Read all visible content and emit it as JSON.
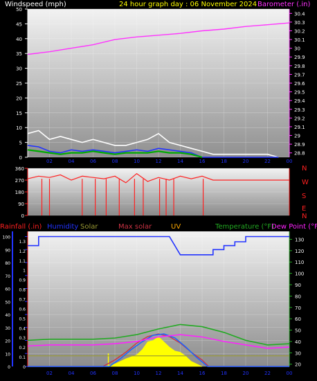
{
  "colors": {
    "white": "#ffffff",
    "yellow": "#ffff00",
    "magenta": "#ff33ff",
    "blue": "#2233ff",
    "green": "#00aa00",
    "red": "#ff2020",
    "uv_orange": "#ffaa00",
    "max_solar": "#cc3344",
    "solar_olive": "#999933",
    "temp_green": "#22aa22",
    "dew_magenta": "#ff22ff"
  },
  "chart_data": [
    {
      "type": "line",
      "name": "wind-barometer",
      "title": "24 hour graph day : 06 November 2024",
      "ylabel_left": "Windspeed (mph)",
      "ylabel_right": "Barometer (.in)",
      "ylim_left": [
        0,
        50
      ],
      "ylim_right": [
        28.75,
        30.45
      ],
      "yticks_left": [
        "0",
        "5",
        "10",
        "15",
        "20",
        "25",
        "30",
        "35",
        "40",
        "45",
        "50"
      ],
      "yticks_right": [
        "28.8",
        "28.9",
        "29",
        "29.1",
        "29.2",
        "29.3",
        "29.4",
        "29.5",
        "29.6",
        "29.7",
        "29.8",
        "29.9",
        "30",
        "30.1",
        "30.2",
        "30.3",
        "30.4"
      ],
      "xticks": [
        "02",
        "04",
        "06",
        "08",
        "10",
        "12",
        "14",
        "16",
        "18",
        "20",
        "22",
        "00"
      ],
      "barometer": {
        "x": [
          0,
          2,
          4,
          6,
          8,
          10,
          12,
          14,
          16,
          18,
          20,
          22,
          24
        ],
        "y": [
          29.93,
          29.96,
          30.0,
          30.04,
          30.1,
          30.13,
          30.15,
          30.17,
          30.2,
          30.22,
          30.25,
          30.27,
          30.29
        ]
      },
      "gust": {
        "x": [
          0,
          1,
          2,
          3,
          4,
          5,
          6,
          7,
          8,
          9,
          10,
          11,
          12,
          13,
          14,
          15,
          16,
          17,
          18,
          19,
          20,
          21,
          22,
          23
        ],
        "y": [
          8,
          9,
          6,
          7,
          6,
          5,
          6,
          5,
          4,
          4,
          5,
          6,
          8,
          5,
          4,
          3,
          2,
          1,
          1,
          1,
          1,
          1,
          1,
          0
        ]
      },
      "avg": {
        "x": [
          0,
          1,
          2,
          3,
          4,
          5,
          6,
          7,
          8,
          9,
          10,
          11,
          12,
          13,
          14,
          15,
          16,
          17,
          18,
          19,
          20,
          21,
          22,
          23
        ],
        "y": [
          4,
          3.5,
          2,
          1.5,
          2.5,
          2,
          2.5,
          2,
          1.5,
          2,
          2.5,
          2,
          3,
          2.5,
          2,
          1.5,
          0,
          0,
          0,
          0,
          0,
          0,
          0,
          0
        ]
      },
      "wind_green": {
        "x": [
          0,
          1,
          2,
          3,
          4,
          5,
          6,
          7,
          8,
          9,
          10,
          11,
          12,
          13,
          14,
          15,
          16
        ],
        "y": [
          2.5,
          2,
          1.5,
          1,
          1.5,
          1.5,
          2,
          1.5,
          1,
          1.5,
          1.5,
          1.5,
          2,
          1.5,
          1.5,
          1,
          0
        ]
      }
    },
    {
      "type": "scatter",
      "name": "wind-direction",
      "yticks_left": [
        "0",
        "90",
        "180",
        "270",
        "360"
      ],
      "ylim": [
        0,
        360
      ],
      "compass": [
        "N",
        "W",
        "S",
        "E",
        "N"
      ],
      "direction": {
        "x": [
          0,
          1,
          2,
          3,
          4,
          5,
          6,
          7,
          8,
          9,
          10,
          11,
          12,
          13,
          14,
          15,
          16,
          17,
          18,
          19,
          20,
          21,
          22,
          23,
          24
        ],
        "y": [
          280,
          300,
          290,
          310,
          270,
          300,
          290,
          280,
          300,
          250,
          320,
          260,
          290,
          270,
          300,
          280,
          300,
          270,
          270,
          270,
          270,
          270,
          270,
          270,
          270
        ]
      }
    },
    {
      "type": "line",
      "name": "weather-multi",
      "labels": {
        "rainfall": "Rainfall (.in)",
        "humidity": "Humidity",
        "solar": "Solar",
        "max_solar": "Max solar",
        "uv": "UV",
        "temperature": "Temperature (°F)",
        "dew_point": "Dew Point (°F"
      },
      "yticks_humidity": [
        "0",
        "10",
        "20",
        "30",
        "40",
        "50",
        "60",
        "70",
        "80",
        "90",
        "100"
      ],
      "yticks_rain": [
        "0",
        "0.1",
        "0.2",
        "0.3",
        "0.4",
        "0.5",
        "0.6",
        "0.7",
        "0.8",
        "0.9",
        "1",
        "1.1",
        "1.2",
        "1.3"
      ],
      "yticks_temp": [
        "20",
        "30",
        "40",
        "50",
        "60",
        "70",
        "80",
        "90",
        "100",
        "110",
        "120",
        "130"
      ],
      "xticks": [
        "02",
        "04",
        "06",
        "08",
        "10",
        "12",
        "14",
        "16",
        "18",
        "20",
        "22",
        "00"
      ],
      "ylim_humidity": [
        0,
        104
      ],
      "ylim_temp": [
        18,
        137
      ],
      "humidity": {
        "x": [
          0,
          1,
          1,
          6,
          11,
          12,
          13,
          14,
          15,
          16,
          17,
          17,
          18,
          18,
          19,
          19,
          20,
          20,
          24
        ],
        "y": [
          93,
          93,
          100,
          100,
          100,
          100,
          100,
          86,
          86,
          86,
          86,
          90,
          90,
          93,
          93,
          96,
          96,
          100,
          100
        ]
      },
      "temperature": {
        "x": [
          0,
          2,
          4,
          6,
          8,
          10,
          12,
          14,
          16,
          18,
          20,
          22,
          24
        ],
        "y": [
          41,
          42,
          42,
          42,
          43,
          46,
          51,
          55,
          53,
          48,
          41,
          37,
          38
        ]
      },
      "dew_point": {
        "x": [
          0,
          2,
          4,
          6,
          8,
          10,
          12,
          14,
          16,
          18,
          20,
          22,
          24
        ],
        "y": [
          36,
          37,
          37,
          37,
          38,
          40,
          44,
          46,
          44,
          40,
          37,
          34,
          35
        ]
      },
      "max_solar": {
        "x": [
          0,
          6.9,
          8,
          9,
          10,
          11,
          12,
          13,
          14,
          15,
          16,
          16.6,
          24
        ],
        "y": [
          0,
          0,
          5,
          11,
          18,
          23,
          25,
          23,
          18,
          11,
          5,
          0,
          0
        ]
      },
      "uv": {
        "x": [
          0,
          7.5,
          8.5,
          9.5,
          10.5,
          11.5,
          12.5,
          13.5,
          14.5,
          15.5,
          16.5,
          24
        ],
        "y": [
          0,
          0,
          6,
          13,
          19,
          24,
          25,
          22,
          15,
          7,
          0,
          0
        ]
      },
      "rain_total": {
        "x": [
          0,
          24
        ],
        "y": [
          0.11,
          0.11
        ]
      },
      "solar": {
        "x": [
          7,
          8,
          9,
          10,
          10.5,
          11,
          11.5,
          12,
          12.5,
          13,
          13.5,
          14,
          14.5,
          15,
          16
        ],
        "y": [
          0,
          2,
          6,
          9,
          13,
          19,
          20,
          23,
          19,
          15,
          12,
          11,
          8,
          4,
          0
        ]
      }
    }
  ]
}
